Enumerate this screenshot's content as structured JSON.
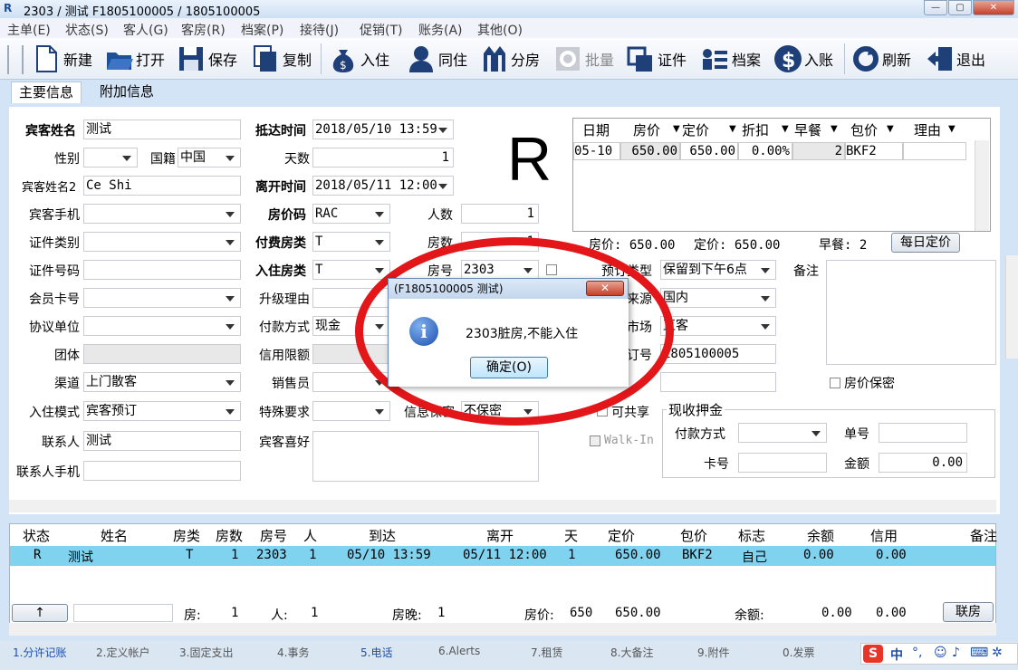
{
  "window": {
    "title": "2303 / 测试 F1805100005 / 1805100005",
    "logo": "R"
  },
  "menu": [
    "主单(E)",
    "状态(S)",
    "客人(G)",
    "客房(R)",
    "档案(P)",
    "接待(J)",
    "促销(T)",
    "账务(A)",
    "其他(O)"
  ],
  "toolbar": {
    "new": "新建",
    "open": "打开",
    "save": "保存",
    "copy": "复制",
    "checkin": "入住",
    "share": "同住",
    "split": "分房",
    "batch": "批量",
    "id": "证件",
    "profile": "档案",
    "post": "入账",
    "refresh": "刷新",
    "exit": "退出"
  },
  "tabs": {
    "main": "主要信息",
    "extra": "附加信息"
  },
  "form": {
    "guest_name_label": "宾客姓名",
    "guest_name": "测试",
    "gender_label": "性别",
    "nationality_label": "国籍",
    "nationality": "中国",
    "guest_name2_label": "宾客姓名2",
    "guest_name2": "Ce Shi",
    "mobile_label": "宾客手机",
    "idtype_label": "证件类别",
    "idno_label": "证件号码",
    "member_label": "会员卡号",
    "agreement_label": "协议单位",
    "group_label": "团体",
    "channel_label": "渠道",
    "channel": "上门散客",
    "mode_label": "入住模式",
    "mode": "宾客预订",
    "contact_label": "联系人",
    "contact": "测试",
    "contact_mobile_label": "联系人手机",
    "arrival_label": "抵达时间",
    "arrival": "2018/05/10 13:59",
    "days_label": "天数",
    "days": "1",
    "depart_label": "离开时间",
    "depart": "2018/05/11 12:00",
    "ratecode_label": "房价码",
    "ratecode": "RAC",
    "persons_label": "人数",
    "persons": "1",
    "paytype_room_label": "付费房类",
    "paytype_room": "T",
    "rooms_label": "房数",
    "rooms": "1",
    "room_type_label": "入住房类",
    "room_type": "T",
    "room_no_label": "房号",
    "room_no": "2303",
    "upgrade_label": "升级理由",
    "payment_label": "付款方式",
    "payment": "现金",
    "credit_label": "信用限额",
    "sales_label": "销售员",
    "special_label": "特殊要求",
    "secret_label": "信息保密",
    "secret": "不保密",
    "pref_label": "宾客喜好",
    "booking_type_label": "预订类型",
    "booking_type": "保留到下午6点",
    "source_label": "来源",
    "source": "国内",
    "market_label": "市场",
    "market": "直客",
    "order_label": "订号",
    "order": "1805100005",
    "remark_label": "备注",
    "rate_secret": "房价保密",
    "shareable": "可共享",
    "walkin": "Walk-In",
    "deposit_label": "现收押金",
    "dep_pay_label": "付款方式",
    "dep_no_label": "单号",
    "dep_card_label": "卡号",
    "dep_amount_label": "金额",
    "dep_amount": "0.00"
  },
  "rate_grid": {
    "headers": [
      "日期",
      "房价",
      "定价",
      "折扣",
      "早餐",
      "包价",
      "理由"
    ],
    "row": [
      "05-10",
      "650.00",
      "650.00",
      "0.00%",
      "2",
      "BKF2",
      ""
    ],
    "summary_rate": "房价: 650.00",
    "summary_price": "定价: 650.00",
    "summary_bkf": "早餐: 2",
    "daily_btn": "每日定价"
  },
  "big_status": "R",
  "dialog": {
    "title": "(F1805100005 测试)",
    "message": "2303脏房,不能入住",
    "ok": "确定(O)"
  },
  "bottom_grid": {
    "headers": [
      "状态",
      "姓名",
      "房类",
      "房数",
      "房号",
      "人",
      "到达",
      "离开",
      "天",
      "定价",
      "包价",
      "标志",
      "余额",
      "信用",
      "备注"
    ],
    "row": [
      "R",
      "测试",
      "T",
      "1",
      "2303",
      "1",
      "05/10 13:59",
      "05/11 12:00",
      "1",
      "650.00",
      "BKF2",
      "自己",
      "0.00",
      "0.00"
    ],
    "footer": {
      "arrow": "↑",
      "rooms_label": "房:",
      "rooms": "1",
      "persons_label": "人:",
      "persons": "1",
      "nights_label": "房晚:",
      "nights": "1",
      "rate_label": "房价:",
      "rate": "650",
      "total": "650.00",
      "balance_label": "余额:",
      "balance": "0.00",
      "credit": "0.00",
      "link_btn": "联房"
    }
  },
  "status_tabs": [
    "1.分许记账",
    "2.定义帐户",
    "3.固定支出",
    "4.事务",
    "5.电话",
    "6.Alerts",
    "7.租赁",
    "8.大备注",
    "9.附件",
    "0.发票"
  ],
  "ime": {
    "logo": "S",
    "lang": "中"
  },
  "colors": {
    "highlight_row": "#7fd3ef",
    "ring": "#e3161a",
    "accent_tab": "#1a4fb0"
  }
}
